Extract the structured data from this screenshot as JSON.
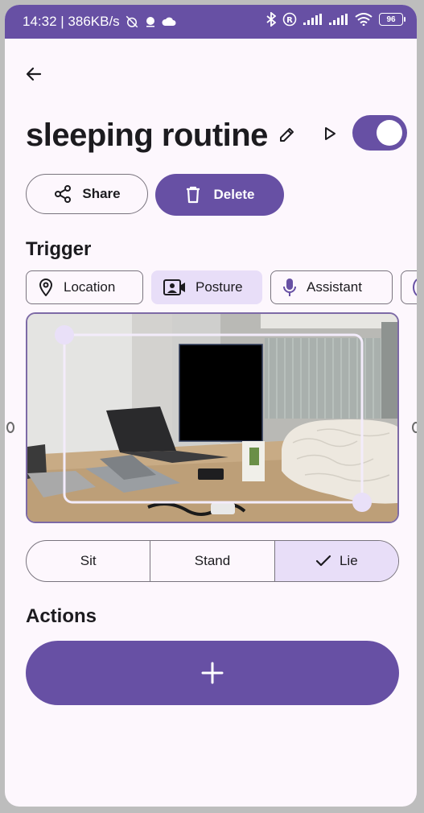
{
  "status_bar": {
    "time_speed": "14:32 | 386KB/s",
    "battery": "96"
  },
  "header": {
    "title": "sleeping routine",
    "toggle_on": true
  },
  "buttons": {
    "share": "Share",
    "delete": "Delete",
    "add": "+"
  },
  "trigger": {
    "heading": "Trigger",
    "chips": [
      {
        "label": "Location",
        "icon": "location-icon",
        "selected": false
      },
      {
        "label": "Posture",
        "icon": "contact-icon",
        "selected": true
      },
      {
        "label": "Assistant",
        "icon": "mic-icon",
        "selected": false
      }
    ]
  },
  "posture": {
    "options": [
      "Sit",
      "Stand",
      "Lie"
    ],
    "selected": "Lie"
  },
  "actions": {
    "heading": "Actions"
  },
  "colors": {
    "primary": "#6750a4",
    "selected_container": "#e8def8",
    "background": "#fdf7fd"
  }
}
